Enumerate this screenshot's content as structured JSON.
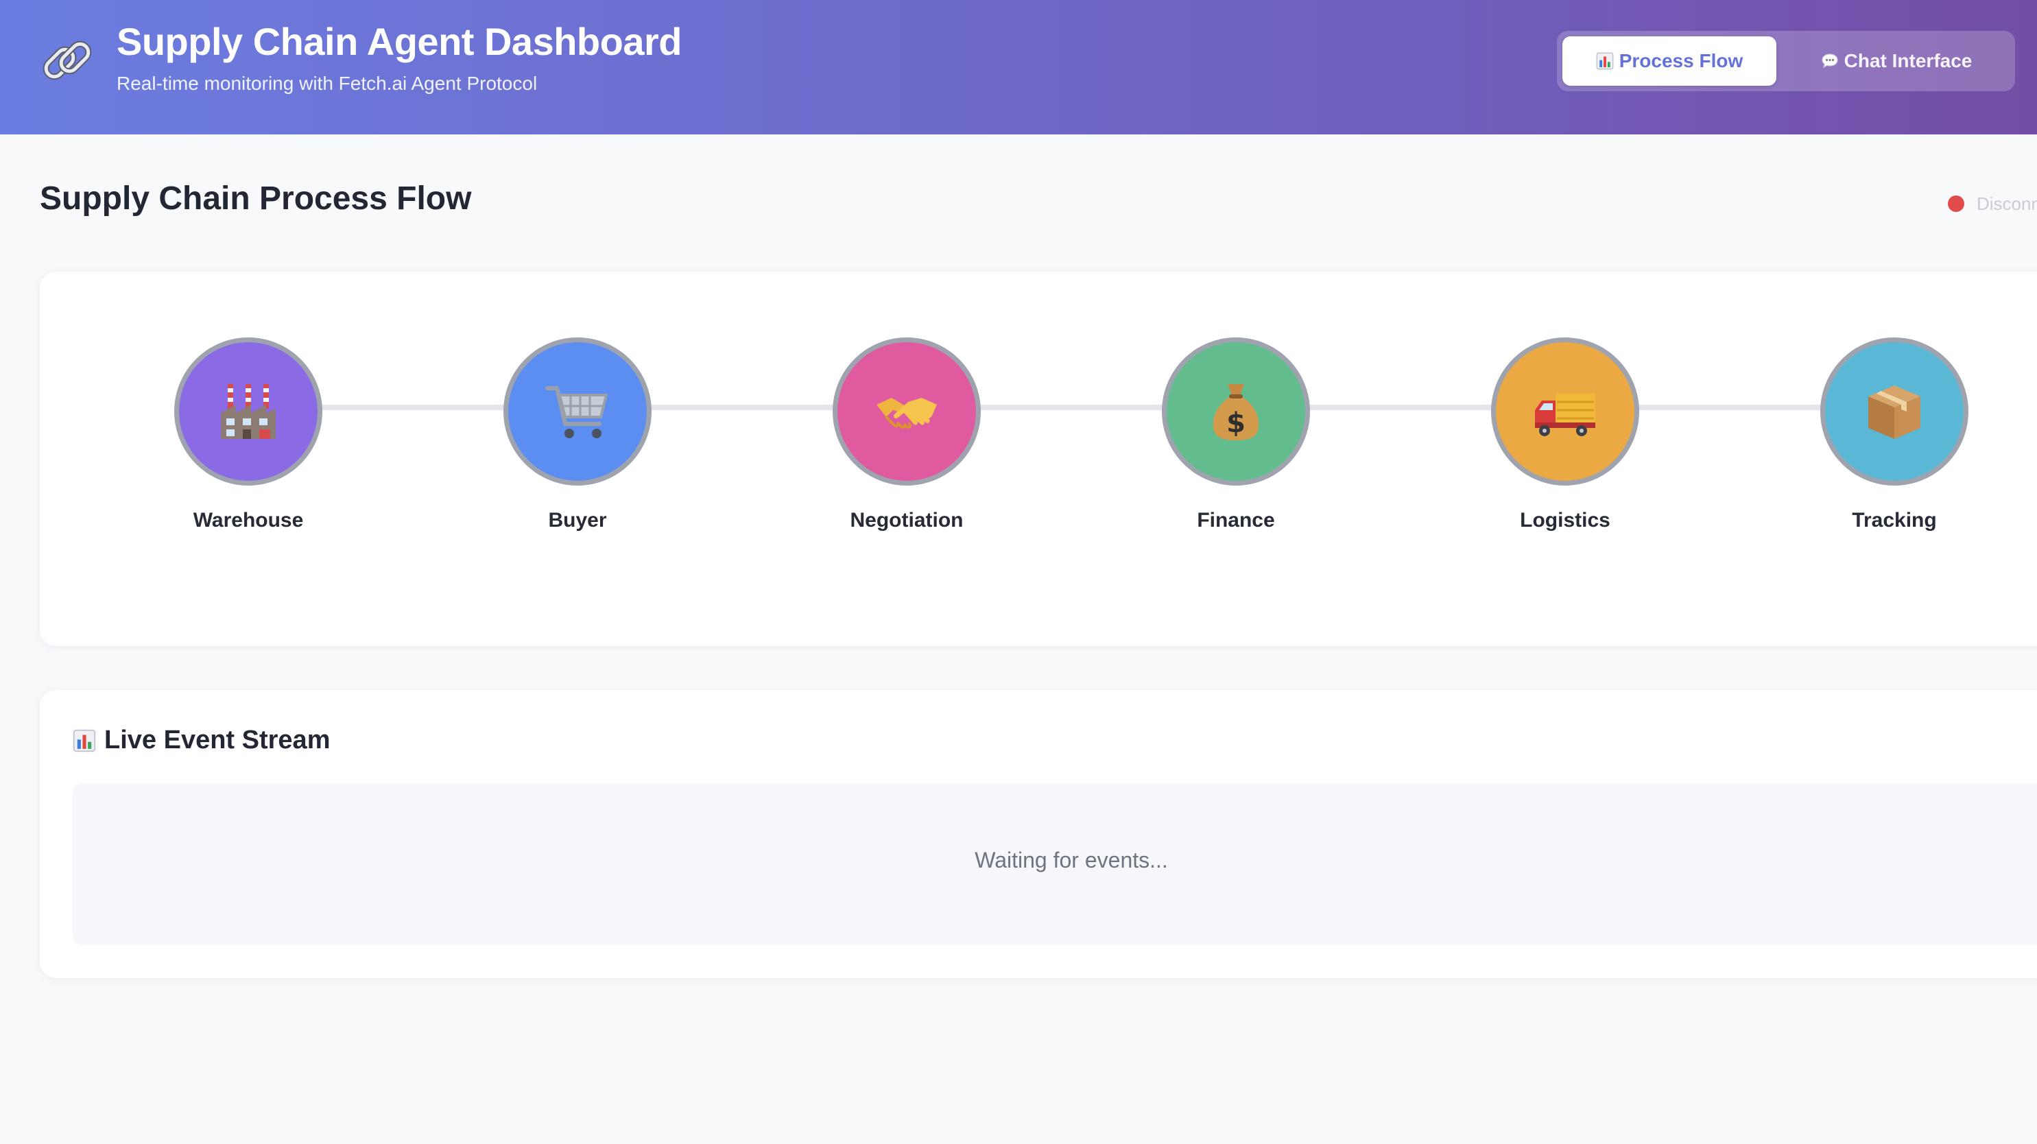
{
  "header": {
    "logo_icon": "link-chain-icon",
    "title": "Supply Chain Agent Dashboard",
    "subtitle": "Real-time monitoring with Fetch.ai Agent Protocol",
    "tabs": [
      {
        "icon": "bar-chart-icon",
        "label": "Process Flow",
        "active": true
      },
      {
        "icon": "speech-bubble-icon",
        "label": "Chat Interface",
        "active": false
      }
    ]
  },
  "process_flow": {
    "title": "Supply Chain Process Flow",
    "connection": {
      "status_color": "#e14b4b",
      "label": "Disconnected"
    },
    "stages": [
      {
        "label": "Warehouse",
        "icon": "factory-icon",
        "color": "#8b6ae6"
      },
      {
        "label": "Buyer",
        "icon": "shopping-cart-icon",
        "color": "#5b8ef0"
      },
      {
        "label": "Negotiation",
        "icon": "handshake-icon",
        "color": "#e05aa0"
      },
      {
        "label": "Finance",
        "icon": "money-bag-icon",
        "color": "#62bc8e"
      },
      {
        "label": "Logistics",
        "icon": "delivery-truck-icon",
        "color": "#eba944"
      },
      {
        "label": "Tracking",
        "icon": "package-icon",
        "color": "#5ab8d6"
      }
    ]
  },
  "event_stream": {
    "icon": "bar-chart-icon",
    "title": "Live Event Stream",
    "empty_text": "Waiting for events..."
  }
}
